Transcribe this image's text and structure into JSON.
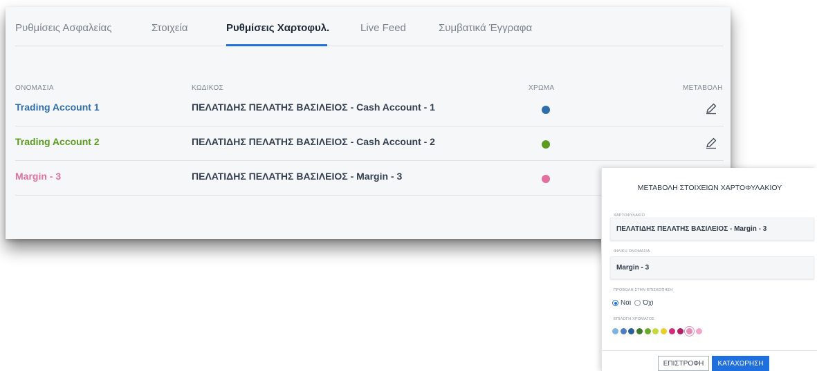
{
  "tabs": [
    {
      "label": "Ρυθμίσεις Ασφαλείας"
    },
    {
      "label": "Στοιχεία"
    },
    {
      "label": "Ρυθμίσεις Χαρτοφυλ."
    },
    {
      "label": "Live Feed"
    },
    {
      "label": "Συμβατικά Έγγραφα"
    }
  ],
  "active_tab": "Ρυθμίσεις Χαρτοφυλ.",
  "table": {
    "headers": {
      "name": "ΟΝΟΜΑΣΙΑ",
      "code": "ΚΩΔΙΚΟΣ",
      "color": "ΧΡΩΜΑ",
      "edit": "ΜΕΤΑΒΟΛΗ"
    },
    "rows": [
      {
        "name": "Trading Account 1",
        "code": "ΠΕΛΑΤΙΔΗΣ ΠΕΛΑΤΗΣ ΒΑΣΙΛΕΙΟΣ - Cash Account - 1",
        "color": "#2f6eab",
        "icon": "edit-pencil-icon"
      },
      {
        "name": "Trading Account 2",
        "code": "ΠΕΛΑΤΙΔΗΣ ΠΕΛΑΤΗΣ ΒΑΣΙΛΕΙΟΣ - Cash Account - 2",
        "color": "#5b9a1f",
        "icon": "edit-pencil-icon"
      },
      {
        "name": "Margin - 3",
        "code": "ΠΕΛΑΤΙΔΗΣ ΠΕΛΑΤΗΣ ΒΑΣΙΛΕΙΟΣ - Margin - 3",
        "color": "#e4709f",
        "icon": "edit-pencil-icon"
      }
    ]
  },
  "dialog": {
    "title": "ΜΕΤΑΒΟΛΗ ΣΤΟΙΧΕΙΩΝ ΧΑΡΤΟΦΥΛΑΚΙΟΥ",
    "portfolio_label": "ΧΑΡΤΟΦΥΛΑΚΙΟ",
    "portfolio_value": "ΠΕΛΑΤΙΔΗΣ ΠΕΛΑΤΗΣ ΒΑΣΙΛΕΙΟΣ - Margin - 3",
    "friendly_name_label": "ΦΙΛΙΚΗ ΟΝΟΜΑΣΙΑ",
    "friendly_name_value": "Margin - 3",
    "overview_label": "ΠΡΟΒΟΛΗ ΣΤΗΝ ΕΠΙΣΚΟΠΗΣΗ",
    "yes_label": "Ναι",
    "no_label": "Όχι",
    "overview_selected": "Ναι",
    "color_label": "ΕΠΙΛΟΓΗ ΧΡΩΜΑΤΟΣ",
    "colors": [
      "#7fb3e0",
      "#4a80bf",
      "#2c5f99",
      "#3f7a2e",
      "#6aab2e",
      "#c5d93a",
      "#e6cf2a",
      "#d42c7d",
      "#b11e64",
      "#e58bb4",
      "#f2a7c8"
    ],
    "selected_color": "#e58bb4",
    "back_button": "ΕΠΙΣΤΡΟΦΗ",
    "save_button": "ΚΑΤΑΧΩΡΗΣΗ"
  },
  "colors": {
    "accent": "#1f6fde",
    "text_dark": "#34404f",
    "text_muted": "#7a838e"
  }
}
